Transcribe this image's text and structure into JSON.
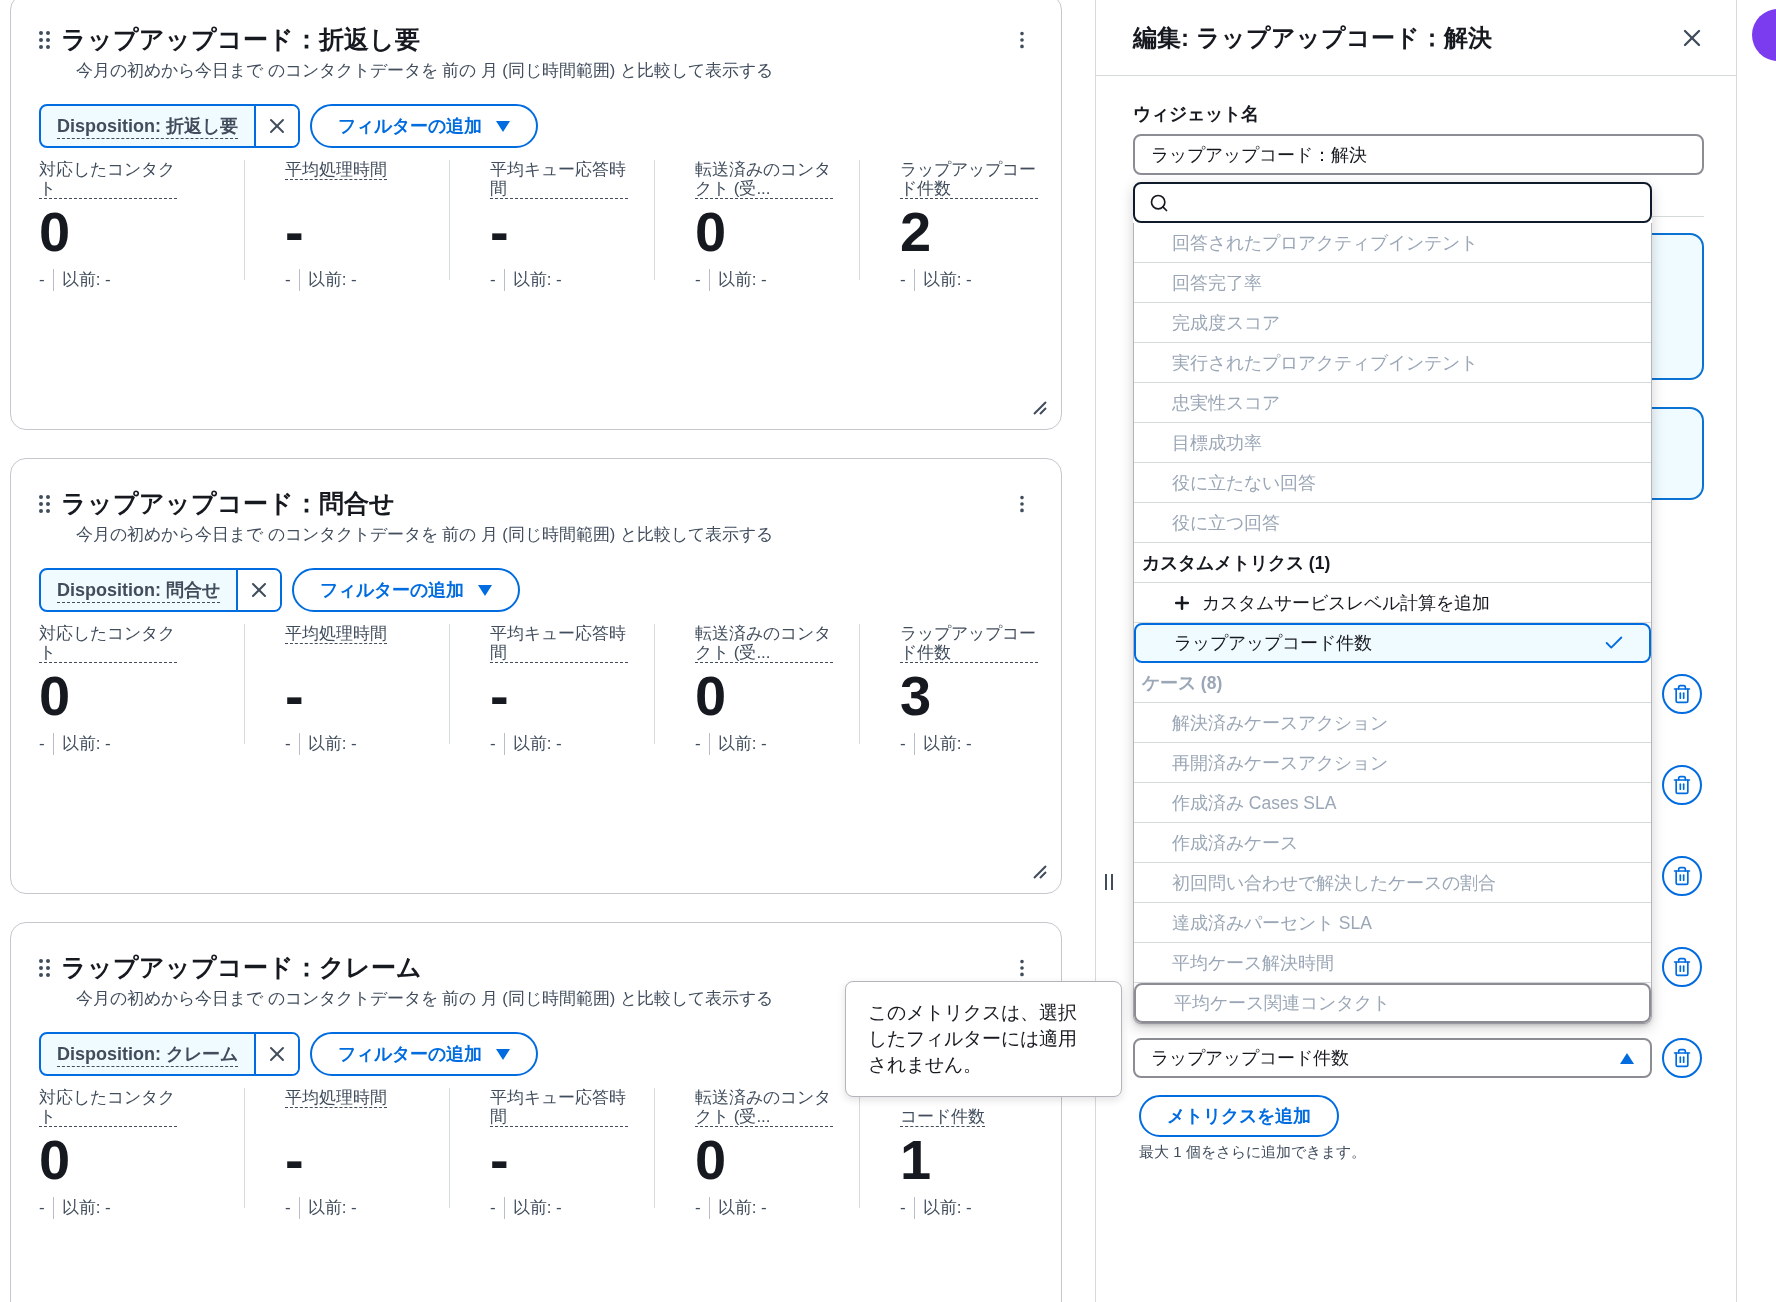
{
  "cards": [
    {
      "title": "ラップアップコード：折返し要",
      "subtitle": "今月の初めから今日まで のコンタクトデータを 前の 月 (同じ時間範囲) と比較して表示する",
      "filter_token": "Disposition: 折返し要",
      "add_filter": "フィルターの追加",
      "resizable": true,
      "metrics": [
        {
          "label": "対応したコンタクト",
          "value": "0",
          "change": "-",
          "previous": "以前: -"
        },
        {
          "label": "平均処理時間",
          "value": "-",
          "change": "-",
          "previous": "以前: -"
        },
        {
          "label": "平均キュー応答時間",
          "value": "-",
          "change": "-",
          "previous": "以前: -"
        },
        {
          "label": "転送済みのコンタクト (受...",
          "value": "0",
          "change": "-",
          "previous": "以前: -"
        },
        {
          "label": "ラップアップコード件数",
          "value": "2",
          "change": "-",
          "previous": "以前: -"
        }
      ]
    },
    {
      "title": "ラップアップコード：問合せ",
      "subtitle": "今月の初めから今日まで のコンタクトデータを 前の 月 (同じ時間範囲) と比較して表示する",
      "filter_token": "Disposition: 問合せ",
      "add_filter": "フィルターの追加",
      "resizable": true,
      "metrics": [
        {
          "label": "対応したコンタクト",
          "value": "0",
          "change": "-",
          "previous": "以前: -"
        },
        {
          "label": "平均処理時間",
          "value": "-",
          "change": "-",
          "previous": "以前: -"
        },
        {
          "label": "平均キュー応答時間",
          "value": "-",
          "change": "-",
          "previous": "以前: -"
        },
        {
          "label": "転送済みのコンタクト (受...",
          "value": "0",
          "change": "-",
          "previous": "以前: -"
        },
        {
          "label": "ラップアップコード件数",
          "value": "3",
          "change": "-",
          "previous": "以前: -"
        }
      ]
    },
    {
      "title": "ラップアップコード：クレーム",
      "subtitle": "今月の初めから今日まで のコンタクトデータを 前の 月 (同じ時間範囲) と比較して表示する",
      "filter_token": "Disposition: クレーム",
      "add_filter": "フィルターの追加",
      "resizable": false,
      "metrics": [
        {
          "label": "対応したコンタクト",
          "value": "0",
          "change": "-",
          "previous": "以前: -"
        },
        {
          "label": "平均処理時間",
          "value": "-",
          "change": "-",
          "previous": "以前: -"
        },
        {
          "label": "平均キュー応答時間",
          "value": "-",
          "change": "-",
          "previous": "以前: -"
        },
        {
          "label": "転送済みのコンタクト (受...",
          "value": "0",
          "change": "-",
          "previous": "以前: -"
        },
        {
          "label": "コード件数",
          "value": "1",
          "change": "-",
          "previous": "以前: -",
          "covered_top": true
        }
      ]
    }
  ],
  "tooltip": "このメトリクスは、選択したフィルターには適用されません。",
  "panel": {
    "title": "編集: ラップアップコード：解決",
    "name_label": "ウィジェット名",
    "name_value": "ラップアップコード：解決",
    "dropdown": [
      {
        "kind": "option",
        "label": "回答されたプロアクティブインテント",
        "disabled": true,
        "selected": false,
        "focused": false
      },
      {
        "kind": "option",
        "label": "回答完了率",
        "disabled": true,
        "selected": false,
        "focused": false
      },
      {
        "kind": "option",
        "label": "完成度スコア",
        "disabled": true,
        "selected": false,
        "focused": false
      },
      {
        "kind": "option",
        "label": "実行されたプロアクティブインテント",
        "disabled": true,
        "selected": false,
        "focused": false
      },
      {
        "kind": "option",
        "label": "忠実性スコア",
        "disabled": true,
        "selected": false,
        "focused": false
      },
      {
        "kind": "option",
        "label": "目標成功率",
        "disabled": true,
        "selected": false,
        "focused": false
      },
      {
        "kind": "option",
        "label": "役に立たない回答",
        "disabled": true,
        "selected": false,
        "focused": false
      },
      {
        "kind": "option",
        "label": "役に立つ回答",
        "disabled": true,
        "selected": false,
        "focused": false
      },
      {
        "kind": "group",
        "label": "カスタムメトリクス (1)",
        "disabled": false
      },
      {
        "kind": "action",
        "label": "カスタムサービスレベル計算を追加"
      },
      {
        "kind": "option",
        "label": "ラップアップコード件数",
        "disabled": false,
        "selected": true,
        "focused": false
      },
      {
        "kind": "group",
        "label": "ケース (8)",
        "disabled": true
      },
      {
        "kind": "option",
        "label": "解決済みケースアクション",
        "disabled": true,
        "selected": false,
        "focused": false
      },
      {
        "kind": "option",
        "label": "再開済みケースアクション",
        "disabled": true,
        "selected": false,
        "focused": false
      },
      {
        "kind": "option",
        "label": "作成済み Cases SLA",
        "disabled": true,
        "selected": false,
        "focused": false
      },
      {
        "kind": "option",
        "label": "作成済みケース",
        "disabled": true,
        "selected": false,
        "focused": false
      },
      {
        "kind": "option",
        "label": "初回問い合わせで解決したケースの割合",
        "disabled": true,
        "selected": false,
        "focused": false
      },
      {
        "kind": "option",
        "label": "達成済みパーセント SLA",
        "disabled": true,
        "selected": false,
        "focused": false
      },
      {
        "kind": "option",
        "label": "平均ケース解決時間",
        "disabled": true,
        "selected": false,
        "focused": false
      },
      {
        "kind": "option",
        "label": "平均ケース関連コンタクト",
        "disabled": true,
        "selected": false,
        "focused": true
      }
    ],
    "metric_select": {
      "value": "ラップアップコード件数",
      "expanded": true
    },
    "add_metric": "メトリクスを追加",
    "helper": "最大 1 個をさらに追加できます。"
  }
}
